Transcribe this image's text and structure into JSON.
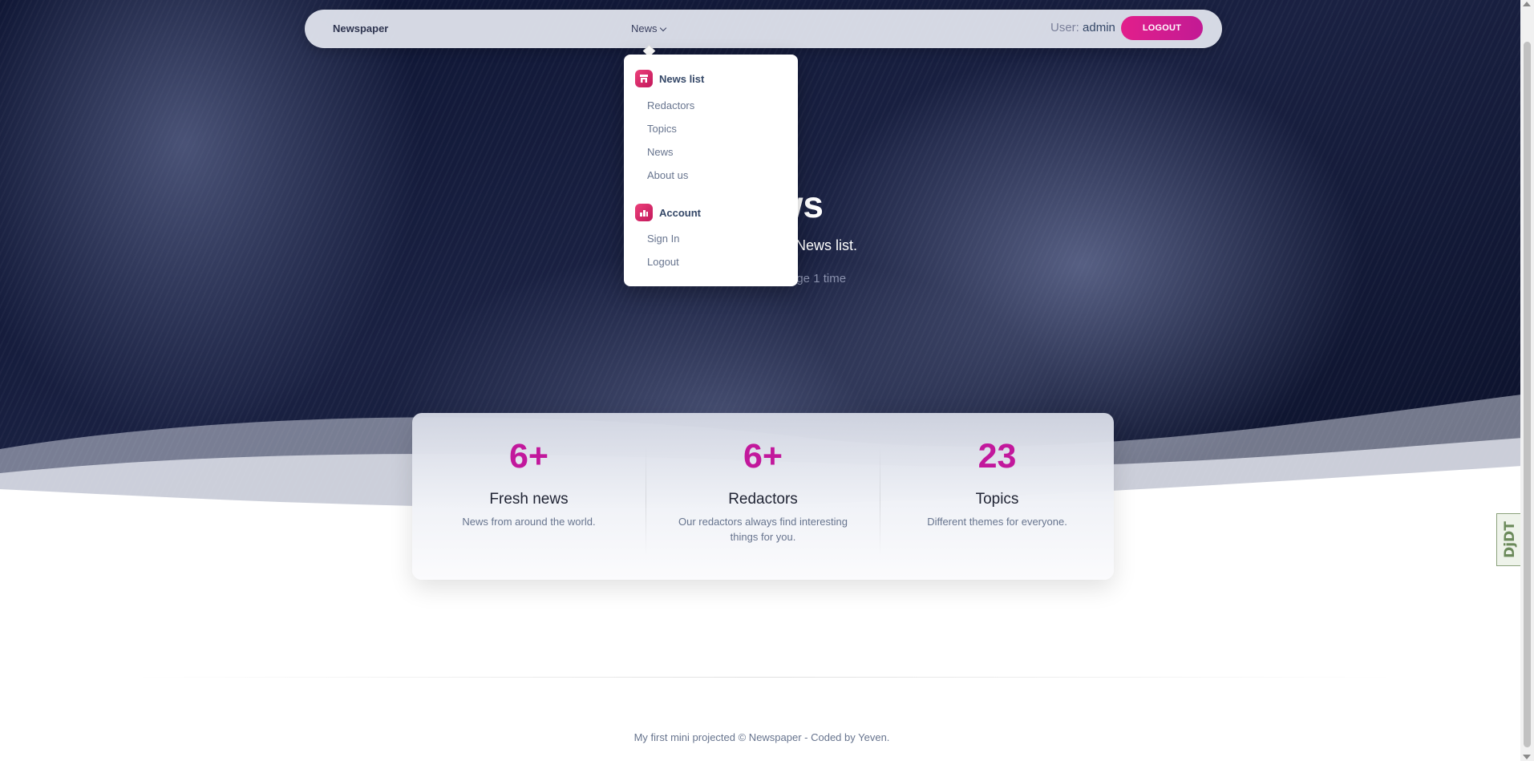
{
  "navbar": {
    "brand": "Newspaper",
    "news_menu": "News",
    "user_label": "User:",
    "user_name": "admin",
    "logout_label": "LOGOUT"
  },
  "hero": {
    "title": "ews",
    "subtitle": "News list.",
    "visits": "age 1 time"
  },
  "dropdown": {
    "sections": [
      {
        "title": "News list",
        "icon": "store-icon",
        "items": [
          "Redactors",
          "Topics",
          "News",
          "About us"
        ]
      },
      {
        "title": "Account",
        "icon": "user-chart-icon",
        "items": [
          "Sign In",
          "Logout"
        ]
      }
    ]
  },
  "stats": [
    {
      "value": "6+",
      "label": "Fresh news",
      "description": "News from around the world."
    },
    {
      "value": "6+",
      "label": "Redactors",
      "description": "Our redactors always find interesting things for you."
    },
    {
      "value": "23",
      "label": "Topics",
      "description": "Different themes for everyone."
    }
  ],
  "footer": {
    "text": "My first mini projected © Newspaper - Coded by Yeven."
  },
  "debug_toolbar": {
    "label": "DjDT"
  },
  "colors": {
    "accent": "#c2189c",
    "logout_button": "#e21f8b",
    "hero_dark": "#0b1230"
  }
}
